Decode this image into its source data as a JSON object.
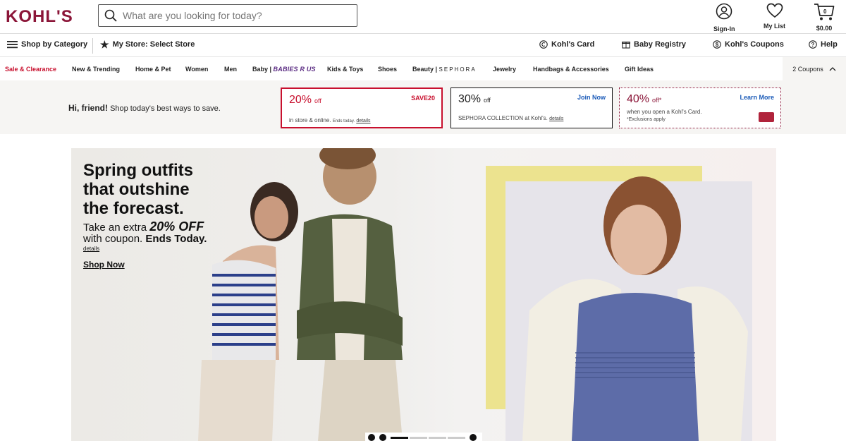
{
  "header": {
    "logo": "KOHL'S",
    "search_placeholder": "What are you looking for today?",
    "signin_label": "Sign-In",
    "mylist_label": "My List",
    "cart_count": "0",
    "cart_total": "$0.00"
  },
  "subnav": {
    "shop_by_category": "Shop by Category",
    "my_store": "My Store: Select Store",
    "kohls_card": "Kohl's Card",
    "baby_registry": "Baby Registry",
    "kohls_coupons": "Kohl's Coupons",
    "help": "Help"
  },
  "categories": {
    "sale": "Sale & Clearance",
    "new": "New & Trending",
    "home": "Home & Pet",
    "women": "Women",
    "men": "Men",
    "baby": "Baby",
    "babiesrus": "BABIES R US",
    "kids": "Kids & Toys",
    "shoes": "Shoes",
    "beauty": "Beauty",
    "sephora": "SEPHORA",
    "jewelry": "Jewelry",
    "handbags": "Handbags & Accessories",
    "gifts": "Gift Ideas",
    "coupons": "2 Coupons"
  },
  "promo": {
    "greeting_bold": "Hi, friend!",
    "greeting_rest": "Shop today's best ways to save.",
    "offer1": {
      "pct": "20%",
      "off": "off",
      "code": "SAVE20",
      "desc": "in store & online.",
      "ends": "Ends today.",
      "details": "details"
    },
    "offer2": {
      "pct": "30%",
      "off": "off",
      "cta": "Join Now",
      "desc": "SEPHORA COLLECTION at Kohl's.",
      "details": "details"
    },
    "offer3": {
      "pct": "40%",
      "off": "off*",
      "cta": "Learn More",
      "desc": "when you open a Kohl's Card.",
      "fine": "*Exclusions apply"
    }
  },
  "hero": {
    "title_line1": "Spring outfits",
    "title_line2": "that outshine",
    "title_line3": "the forecast.",
    "sub_pre": "Take an extra",
    "sub_pct": "20% OFF",
    "sub_line2_pre": "with coupon.",
    "sub_line2_bold": "Ends Today.",
    "details": "details",
    "shop_now": "Shop Now"
  }
}
